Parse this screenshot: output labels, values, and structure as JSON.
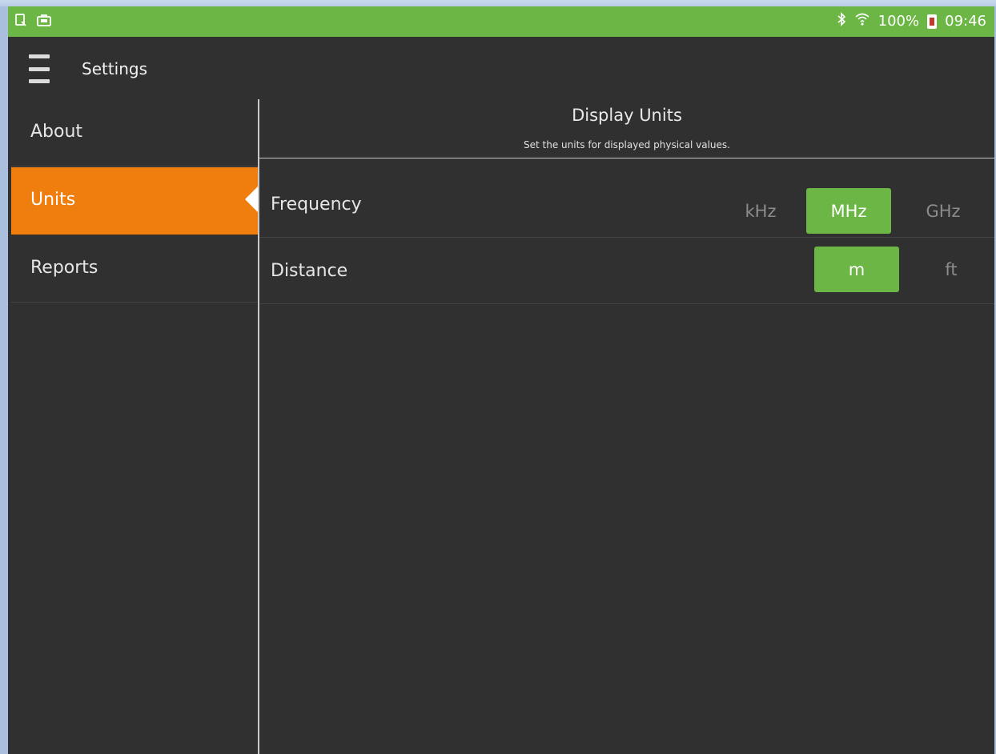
{
  "status_bar": {
    "left_icons": [
      "screenshot-icon",
      "briefcase-icon"
    ],
    "right_icons": [
      "bluetooth-icon",
      "wifi-icon",
      "battery-icon"
    ],
    "battery_text": "100%",
    "time": "09:46"
  },
  "app_bar": {
    "menu_icon": "hamburger-menu-icon",
    "title": "Settings"
  },
  "sidebar": {
    "items": [
      {
        "label": "About"
      },
      {
        "label": "Units"
      },
      {
        "label": "Reports"
      }
    ],
    "selected": "Units"
  },
  "content": {
    "title": "Display Units",
    "subtitle": "Set the units for displayed physical values.",
    "settings": [
      {
        "label": "Frequency",
        "options": [
          "kHz",
          "MHz",
          "GHz"
        ],
        "selected": "MHz"
      },
      {
        "label": "Distance",
        "options": [
          "m",
          "ft"
        ],
        "selected": "m"
      }
    ]
  },
  "colors": {
    "status_bar": "#6cb645",
    "accent_orange": "#f07e0e",
    "selected_green": "#6cb645",
    "background": "#303030"
  }
}
